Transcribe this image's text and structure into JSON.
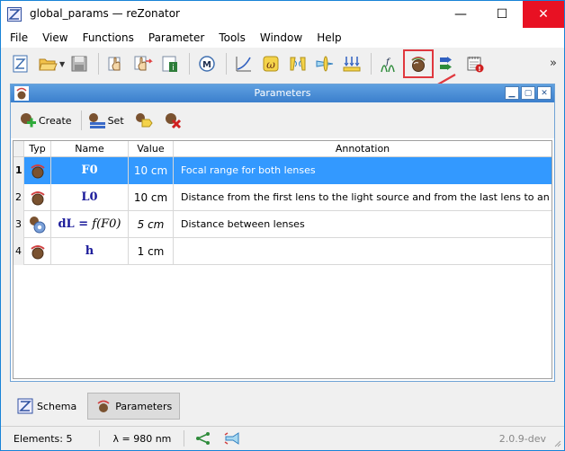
{
  "window": {
    "title": "global_params — reZonator"
  },
  "window_controls": {
    "minimize": "—",
    "maximize": "☐",
    "close": "✕"
  },
  "menu": [
    "File",
    "View",
    "Functions",
    "Parameter",
    "Tools",
    "Window",
    "Help"
  ],
  "toolbar": {
    "more_label": "»"
  },
  "subwindow": {
    "title": "Parameters",
    "toolbar": {
      "create_label": "Create",
      "set_label": "Set"
    }
  },
  "table": {
    "headers": [
      "Typ",
      "Name",
      "Value",
      "Annotation"
    ],
    "rows": [
      {
        "num": "1",
        "name": "F0",
        "value": "10 cm",
        "annotation": "Focal range for both lenses",
        "selected": true
      },
      {
        "num": "2",
        "name": "L0",
        "value": "10 cm",
        "annotation": "Distance from the first lens to the light source and from the last lens to an i..."
      },
      {
        "num": "3",
        "name": "dL = f(F0)",
        "value": "5 cm",
        "annotation": "Distance between lenses"
      },
      {
        "num": "4",
        "name": "h",
        "value": "1 cm",
        "annotation": ""
      }
    ]
  },
  "bottom_tabs": {
    "schema_label": "Schema",
    "parameters_label": "Parameters"
  },
  "status": {
    "elements": "Elements: 5",
    "lambda": "λ = 980 nm",
    "version": "2.0.9-dev"
  },
  "colors": {
    "selection": "#3399ff",
    "highlight_border": "#e0383e",
    "close_button": "#e81123",
    "title_gradient_top": "#5fa0e0",
    "name_text": "#1a1a9a"
  }
}
